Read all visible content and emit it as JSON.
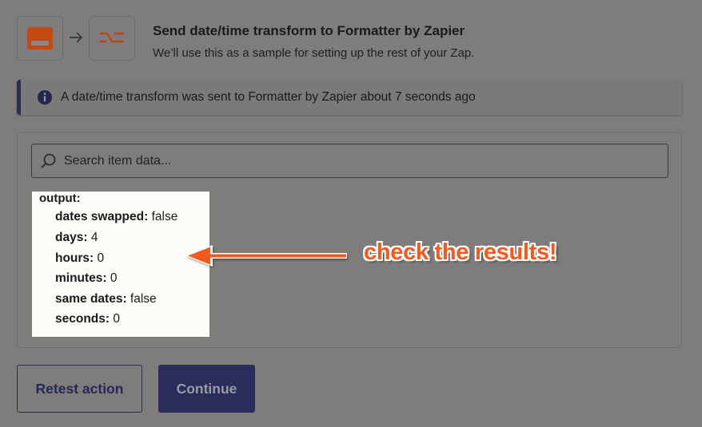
{
  "header": {
    "title": "Send date/time transform to Formatter by Zapier",
    "subtitle": "We’ll use this as a sample for setting up the rest of your Zap.",
    "trigger_icon": "formatter-app-icon",
    "action_icon": "formatter-transform-icon",
    "arrow_icon": "arrow-right-icon"
  },
  "banner": {
    "icon": "info-icon",
    "text": "A date/time transform was sent to Formatter by Zapier about 7 seconds ago"
  },
  "search": {
    "icon": "search-icon",
    "placeholder": "Search item data..."
  },
  "output": {
    "heading": "output:",
    "rows": [
      {
        "key": "dates swapped:",
        "value": "false"
      },
      {
        "key": "days:",
        "value": "4"
      },
      {
        "key": "hours:",
        "value": "0"
      },
      {
        "key": "minutes:",
        "value": "0"
      },
      {
        "key": "same dates:",
        "value": "false"
      },
      {
        "key": "seconds:",
        "value": "0"
      }
    ]
  },
  "annotation": {
    "text": "check the results!",
    "color": "#f25a1f"
  },
  "buttons": {
    "retest": "Retest action",
    "continue": "Continue"
  },
  "colors": {
    "brand_orange": "#e8591a",
    "navy": "#2a2c5a",
    "overlay_bg": "#7e7d7b"
  }
}
